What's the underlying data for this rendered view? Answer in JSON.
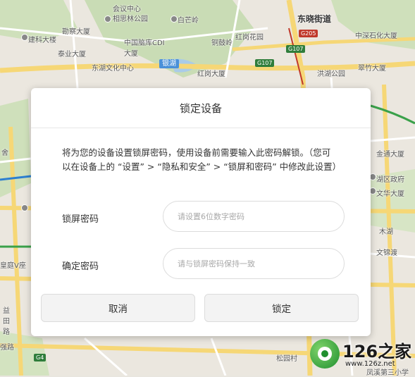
{
  "map": {
    "labels": [
      "勘察大厦",
      "相思林公园",
      "白芒岭",
      "东晓街道",
      "建科大楼",
      "中国脑库CDI大厦",
      "铜鼓岭",
      "红岗花园",
      "中深石化大厦",
      "泰业大厦",
      "东湖文化中心",
      "红岗大厦",
      "洪湖公园",
      "翠竹大厦",
      "会议中心",
      "金通大厦",
      "湖区政府",
      "文华大厦",
      "木湖",
      "文锦渡",
      "皇庭V座",
      "益田路",
      "强路",
      "松园村",
      "凤溪第三小学",
      "舍"
    ],
    "road_shields": [
      "G205",
      "G107",
      "G107",
      "G4"
    ],
    "lake": "银湖"
  },
  "dialog": {
    "title": "锁定设备",
    "description": "将为您的设备设置锁屏密码，使用设备前需要输入此密码解锁。（您可以在设备上的 “设置” > “隐私和安全” > “锁屏和密码” 中修改此设置）",
    "lock_password": {
      "label": "锁屏密码",
      "placeholder": "请设置6位数字密码",
      "value": ""
    },
    "confirm_password": {
      "label": "确定密码",
      "placeholder": "请与锁屏密码保持一致",
      "value": ""
    },
    "cancel_label": "取消",
    "confirm_label": "锁定"
  },
  "watermark": {
    "brand": "126之家",
    "url": "www.126z.net"
  }
}
